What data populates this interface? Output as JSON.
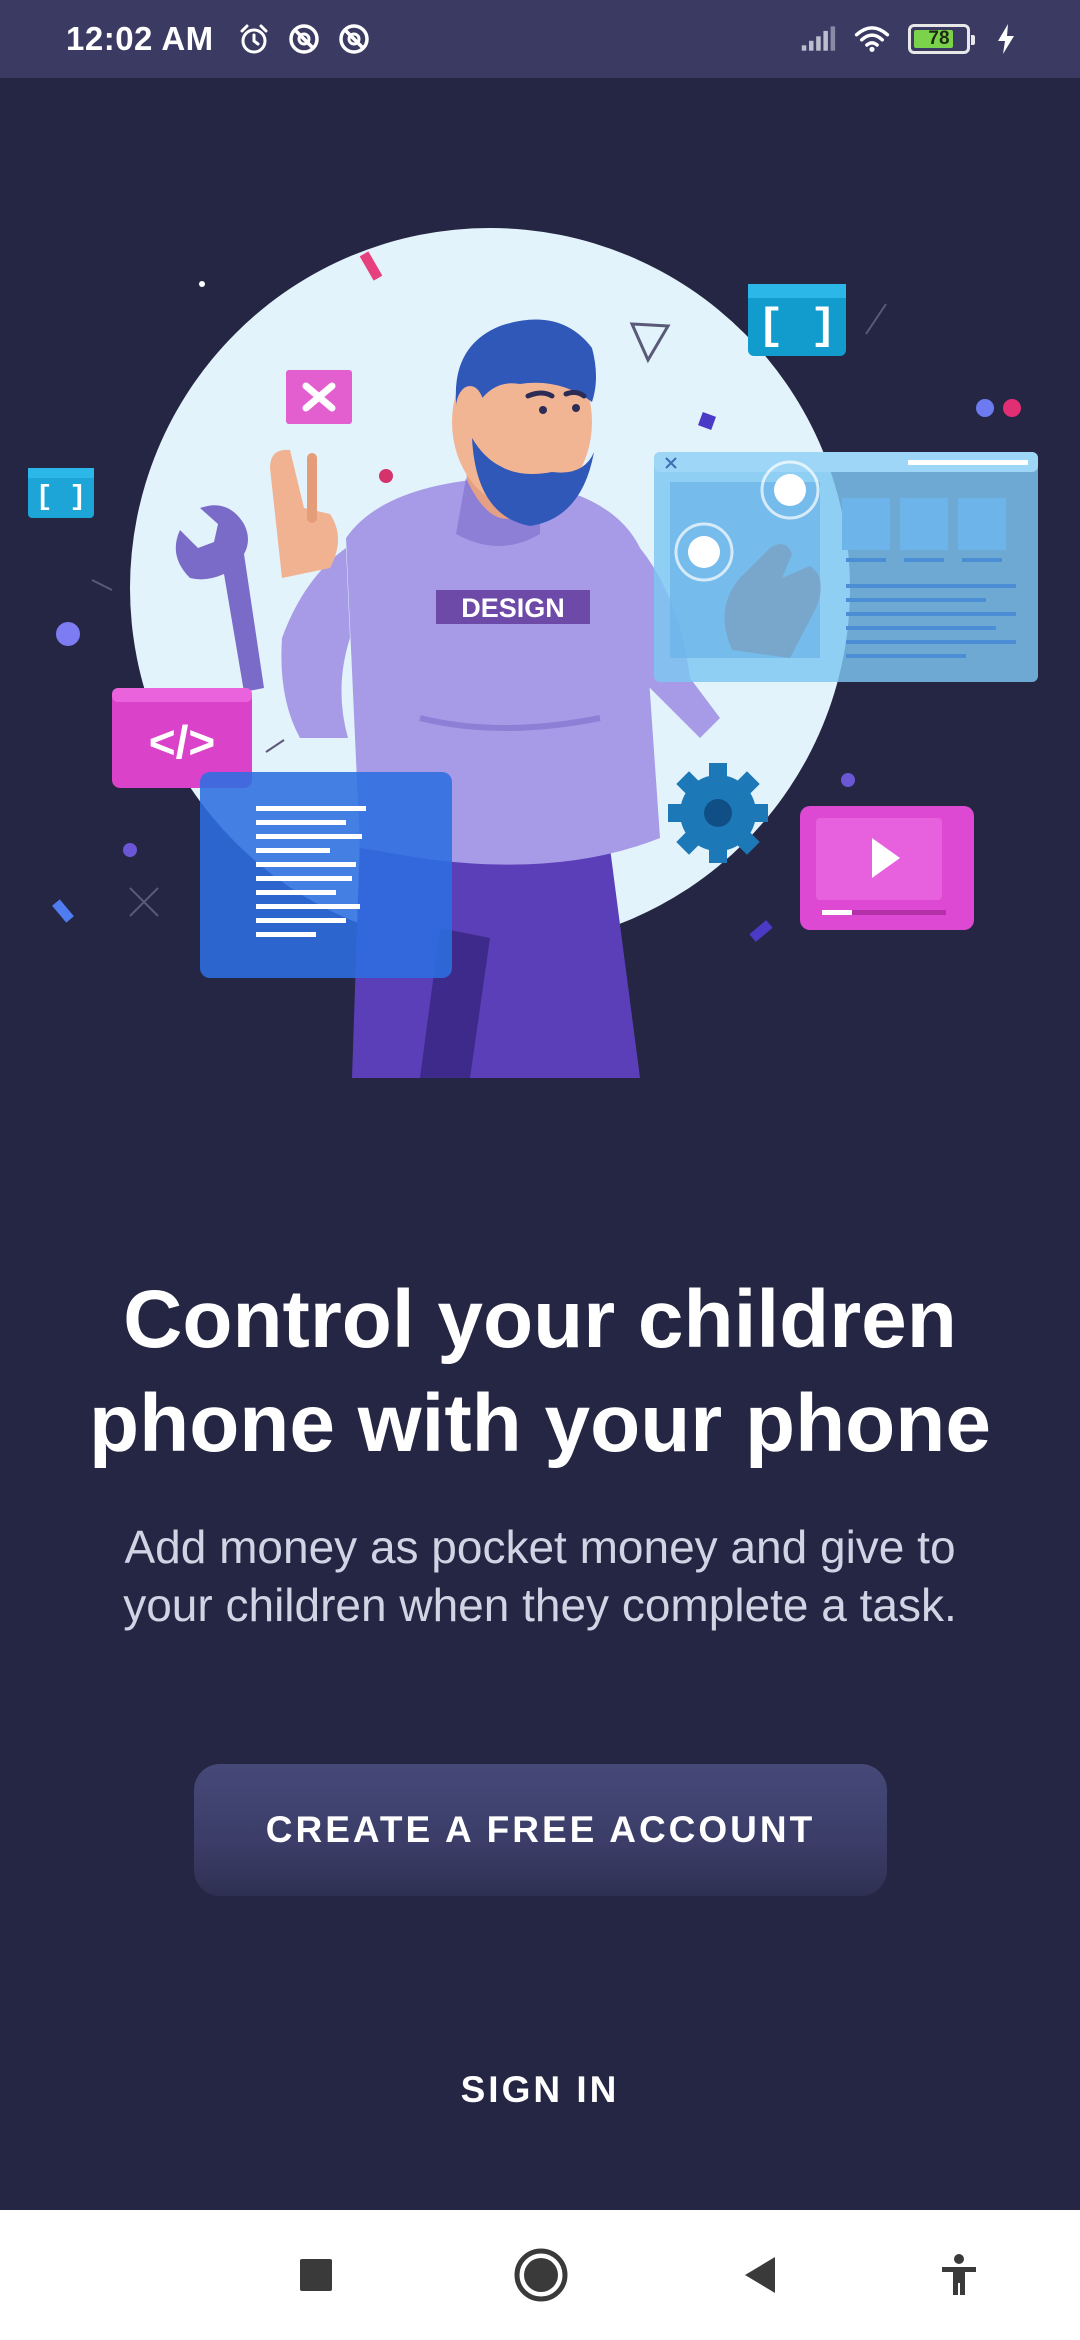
{
  "status_bar": {
    "time": "12:02 AM",
    "left_icons": [
      "alarm-icon",
      "do-not-disturb-icon",
      "do-not-disturb-icon"
    ],
    "right_icons": [
      "signal-icon",
      "wifi-icon",
      "battery-icon",
      "charging-icon"
    ],
    "battery_level": "78",
    "battery_fraction": 0.78,
    "battery_color": "#7ad34a"
  },
  "illustration": {
    "shirt_text": "DESIGN",
    "code_tag": "</>",
    "bracket_tag": "[ ]",
    "small_bracket_tag": "[ ]"
  },
  "onboarding": {
    "headline_line1": "Control your children",
    "headline_line2": "phone with your phone",
    "subtitle_line1": "Add money as pocket money and give to",
    "subtitle_line2": "your children when they complete a task."
  },
  "actions": {
    "create_account_label": "CREATE A FREE ACCOUNT",
    "sign_in_label": "SIGN IN"
  },
  "nav_bar": {
    "icons": [
      "recents-icon",
      "home-icon",
      "back-icon",
      "accessibility-icon"
    ]
  },
  "colors": {
    "background": "#252643",
    "status_bar": "#3a3a63",
    "button": "#3f416d"
  }
}
